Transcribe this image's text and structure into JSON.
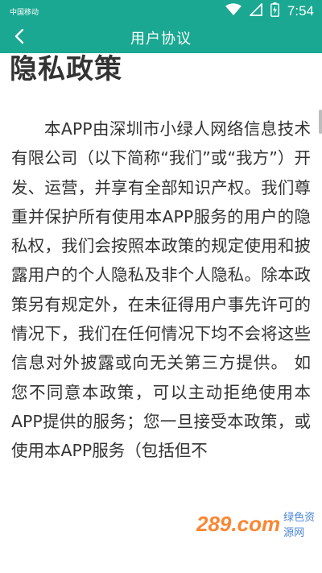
{
  "status_bar": {
    "carrier": "中国移动",
    "time": "7:54",
    "icons": [
      "wifi-icon",
      "signal-icon",
      "battery-icon"
    ]
  },
  "app_bar": {
    "title": "用户协议",
    "back_icon": "back-arrow-icon"
  },
  "document": {
    "heading": "隐私政策",
    "paragraph": "本APP由深圳市小绿人网络信息技术有限公司（以下简称“我们”或“我方”）开发、运营，并享有全部知识产权。我们尊重并保护所有使用本APP服务的用户的隐私权，我们会按照本政策的规定使用和披露用户的个人隐私及非个人隐私。除本政策另有规定外，在未征得用户事先许可的情况下，我们在任何情况下均不会将这些信息对外披露或向无关第三方提供。 如您不同意本政策，可以主动拒绝使用本APP提供的服务；您一旦接受本政策，或使用本APP服务（包括但不"
  },
  "watermark": {
    "logo": "289.com",
    "sub": "绿色资源网"
  },
  "colors": {
    "primary": "#1aa892",
    "text": "#333333",
    "background": "#ffffff"
  }
}
